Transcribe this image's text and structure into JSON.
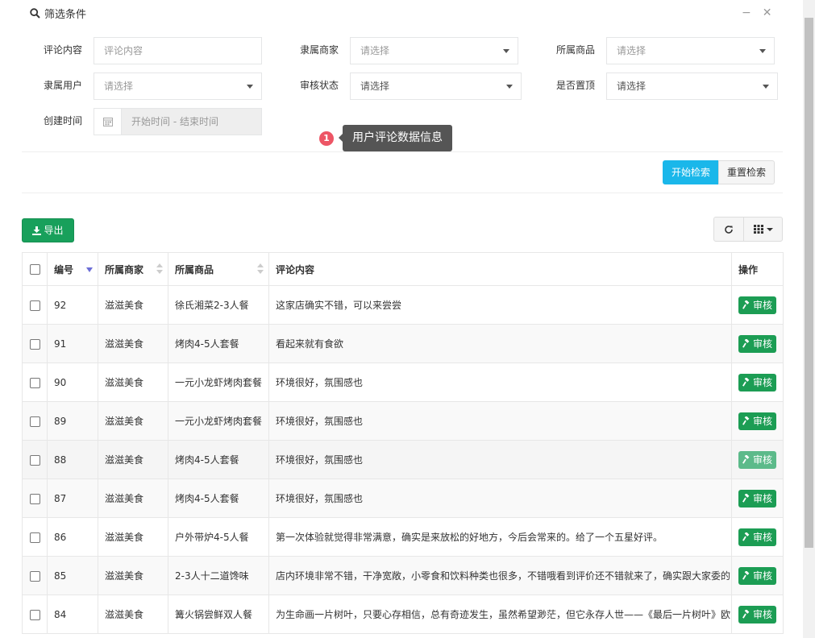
{
  "filter": {
    "title": "筛选条件",
    "minimize_icon": "minus-icon",
    "close_icon": "close-icon",
    "fields": {
      "comment": {
        "label": "评论内容",
        "placeholder": "评论内容"
      },
      "merchant": {
        "label": "隶属商家",
        "value": "请选择"
      },
      "product": {
        "label": "所属商品",
        "value": "请选择"
      },
      "user": {
        "label": "隶属用户",
        "value": "请选择"
      },
      "status": {
        "label": "审核状态",
        "value": "请选择"
      },
      "pinned": {
        "label": "是否置顶",
        "value": "请选择"
      },
      "created": {
        "label": "创建时间",
        "placeholder": "开始时间 - 结束时间"
      }
    },
    "search_label": "开始检索",
    "reset_label": "重置检索"
  },
  "tooltip": {
    "badge": "1",
    "text": "用户评论数据信息"
  },
  "toolbar": {
    "export_label": "导出"
  },
  "table": {
    "headers": {
      "id": "编号",
      "merchant": "所属商家",
      "product": "所属商品",
      "content": "评论内容",
      "action": "操作"
    },
    "action_label": "审核",
    "rows": [
      {
        "id": "92",
        "merchant": "滋滋美食",
        "product": "徐氏湘菜2-3人餐",
        "content": "这家店确实不错，可以来尝尝"
      },
      {
        "id": "91",
        "merchant": "滋滋美食",
        "product": "烤肉4-5人套餐",
        "content": "看起来就有食欲"
      },
      {
        "id": "90",
        "merchant": "滋滋美食",
        "product": "一元小龙虾烤肉套餐",
        "content": "环境很好，氛围感也"
      },
      {
        "id": "89",
        "merchant": "滋滋美食",
        "product": "一元小龙虾烤肉套餐",
        "content": "环境很好，氛围感也"
      },
      {
        "id": "88",
        "merchant": "滋滋美食",
        "product": "烤肉4-5人套餐",
        "content": "环境很好，氛围感也"
      },
      {
        "id": "87",
        "merchant": "滋滋美食",
        "product": "烤肉4-5人套餐",
        "content": "环境很好，氛围感也"
      },
      {
        "id": "86",
        "merchant": "滋滋美食",
        "product": "户外带炉4-5人餐",
        "content": "第一次体验就觉得非常满意，确实是来放松的好地方，今后会常来的。给了一个五星好评。"
      },
      {
        "id": "85",
        "merchant": "滋滋美食",
        "product": "2-3人十二道馋味",
        "content": "店内环境非常不错，干净宽敞，小零食和饮料种类也很多，不错哦看到评价还不错就来了，确实跟大家委的"
      },
      {
        "id": "84",
        "merchant": "滋滋美食",
        "product": "篝火锅尝鲜双人餐",
        "content": "为生命画一片树叶，只要心存相信，总有奇迹发生，虽然希望渺茫，但它永存人世——《最后一片树叶》欧"
      }
    ]
  },
  "colors": {
    "primary": "#1ab7ea",
    "success": "#1c9d54",
    "danger": "#ed5565"
  }
}
